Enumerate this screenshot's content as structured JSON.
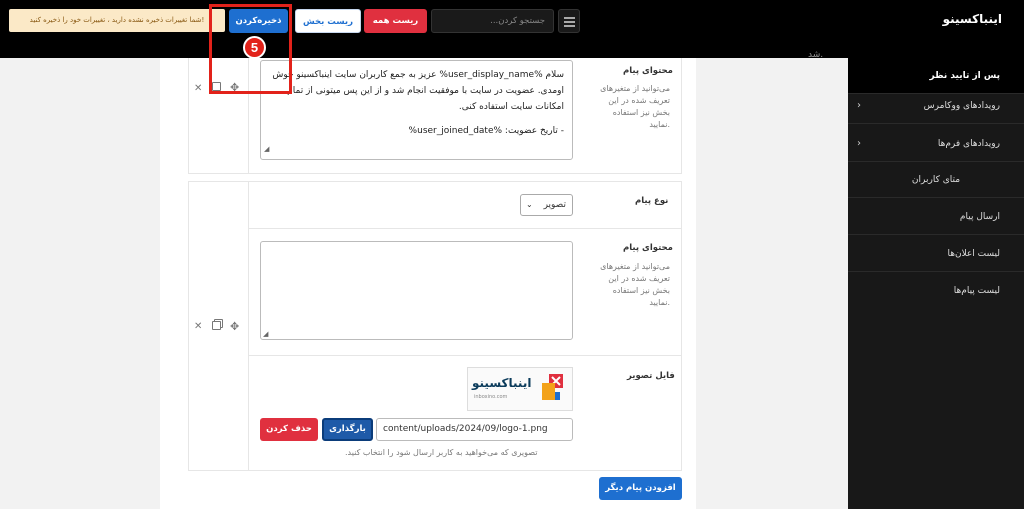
{
  "header": {
    "brand": "اینباکسینو",
    "warning": "شما تغییرات ذخیره نشده دارید ، تغییرات خود را ذخیره کنید!",
    "save_label": "ذخیره‌کردن",
    "reset_section_label": "ریست بخش",
    "reset_all_label": "ریست همه",
    "search_placeholder": "جستجو کردن..."
  },
  "sidebar": {
    "items": [
      {
        "label": "پس از تایید نظر",
        "active": true
      },
      {
        "label": "رویدادهای ووکامرس",
        "has_children": true
      },
      {
        "label": "رویدادهای فرم‌ها",
        "has_children": true
      },
      {
        "label": "متای کاربران"
      },
      {
        "label": "ارسال پیام"
      },
      {
        "label": "لیست اعلان‌ها"
      },
      {
        "label": "لیست پیام‌ها"
      }
    ]
  },
  "main": {
    "top_fragment": "شد.",
    "block1": {
      "content_label": "محتوای پیام",
      "content_hint": "می‌توانید از متغیرهای تعریف شده در این بخش نیز استفاده نمایید.",
      "message_line1": "سلام %user_display_name% عزیز به جمع کاربران سایت اینباکسینو خوش اومدی. عضویت در سایت با موفقیت انجام شد و از این پس میتونی از تمام امکانات سایت استفاده کنی.",
      "message_line2": "- تاریخ عضویت: %user_joined_date%"
    },
    "block2": {
      "type_label": "نوع پیام",
      "type_value": "تصویر",
      "content_label": "محتوای پیام",
      "content_hint": "می‌توانید از متغیرهای تعریف شده در این بخش نیز استفاده نمایید.",
      "message": "",
      "image_label": "فایل تصویر",
      "logo_text": "اینباکسینو",
      "logo_sub": "inboxino.com",
      "image_url": "content/uploads/2024/09/logo-1.png",
      "upload_label": "بارگذاری",
      "delete_label": "حذف کردن",
      "image_hint": "تصویری که می‌خواهید به کاربر ارسال شود را انتخاب کنید."
    },
    "add_message_label": "افزودن پیام دیگر"
  },
  "annotation": {
    "number": "5"
  }
}
